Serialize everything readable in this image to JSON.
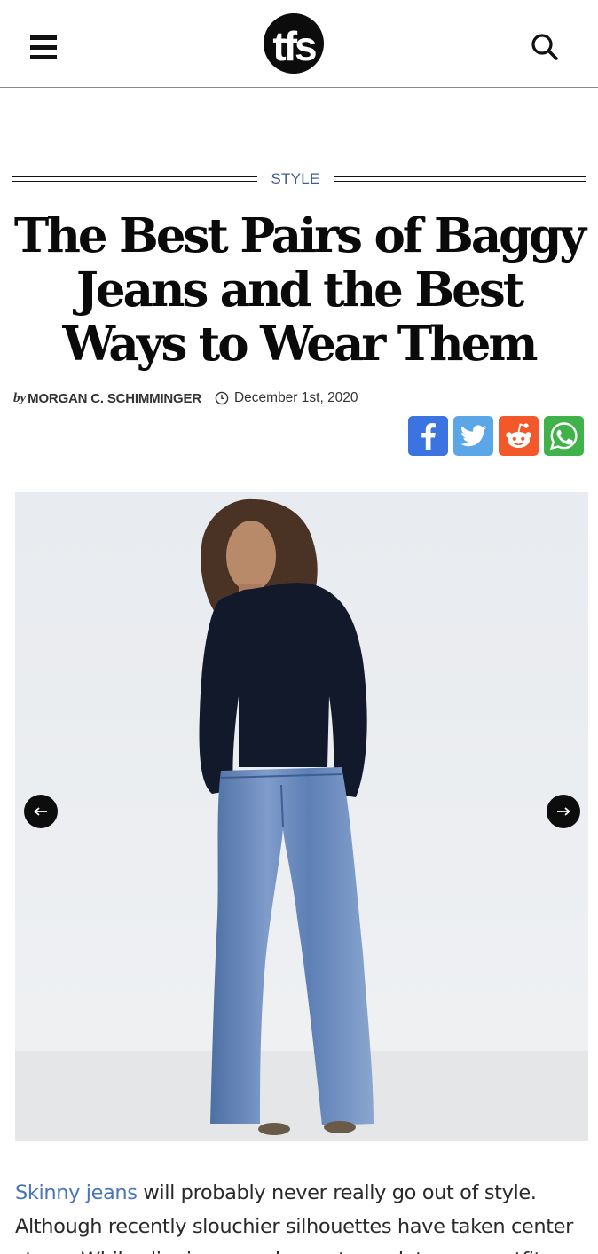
{
  "header": {
    "logo_text": "tfs",
    "menu_icon": "hamburger-icon",
    "search_icon": "search-icon"
  },
  "article": {
    "category": "STYLE",
    "headline": "The Best Pairs of Baggy Jeans and the Best Ways to Wear Them",
    "byline_prefix": "by",
    "author": "MORGAN C. SCHIMMINGER",
    "date": "December 1st, 2020",
    "share": [
      {
        "network": "facebook",
        "icon": "facebook-icon"
      },
      {
        "network": "twitter",
        "icon": "twitter-icon"
      },
      {
        "network": "reddit",
        "icon": "reddit-icon"
      },
      {
        "network": "whatsapp",
        "icon": "whatsapp-icon"
      }
    ],
    "slider": {
      "prev_icon": "arrow-left-icon",
      "next_icon": "arrow-right-icon"
    },
    "body": {
      "link_text": "Skinny jeans",
      "text": " will probably never really go out of style. Although recently slouchier silhouettes have taken center stage. While slim jeans and ones to pack to your outfit"
    }
  },
  "colors": {
    "category": "#3e5e93",
    "link": "#4a76b9",
    "facebook": "#3b73e0",
    "twitter": "#5aa6e6",
    "reddit": "#f2582a",
    "whatsapp": "#3fb34a"
  }
}
